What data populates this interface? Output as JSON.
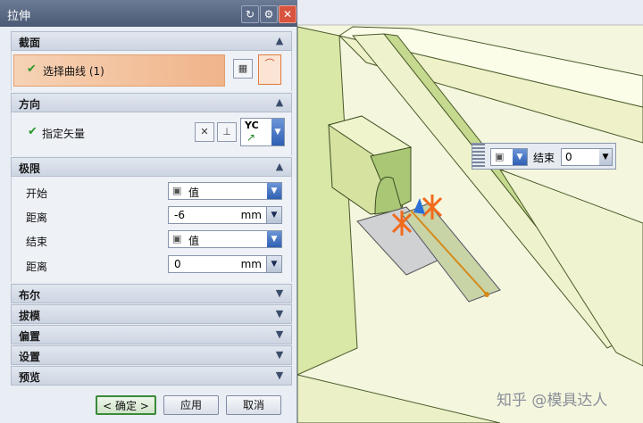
{
  "dialog": {
    "title": "拉伸",
    "title_icons": [
      "reset-icon",
      "gear-icon",
      "close-icon"
    ],
    "sections": {
      "section": {
        "label": "截面",
        "item_label": "选择曲线 (1)",
        "expanded": true
      },
      "direction": {
        "label": "方向",
        "item_label": "指定矢量",
        "vector_combo_label": "YC",
        "expanded": true
      },
      "limits": {
        "label": "极限",
        "expanded": true,
        "start_label": "开始",
        "start_value": "值",
        "start_distance_label": "距离",
        "start_distance_value": "-6",
        "start_distance_unit": "mm",
        "end_label": "结束",
        "end_value": "值",
        "end_distance_label": "距离",
        "end_distance_value": "0",
        "end_distance_unit": "mm"
      },
      "boolean": {
        "label": "布尔",
        "expanded": false
      },
      "draft": {
        "label": "拔模",
        "expanded": false
      },
      "offset": {
        "label": "偏置",
        "expanded": false
      },
      "settings": {
        "label": "设置",
        "expanded": false
      },
      "preview": {
        "label": "预览",
        "expanded": false
      }
    },
    "buttons": {
      "ok": "< 确定 >",
      "apply": "应用",
      "cancel": "取消"
    }
  },
  "floating_end": {
    "label": "结束",
    "value": "0"
  },
  "watermark": "知乎 @模具达人",
  "colors": {
    "highlight_section": "#f0b48a",
    "model_face": "#eef2c9",
    "model_green": "#b5d089",
    "accent_orange": "#f26a1b"
  }
}
